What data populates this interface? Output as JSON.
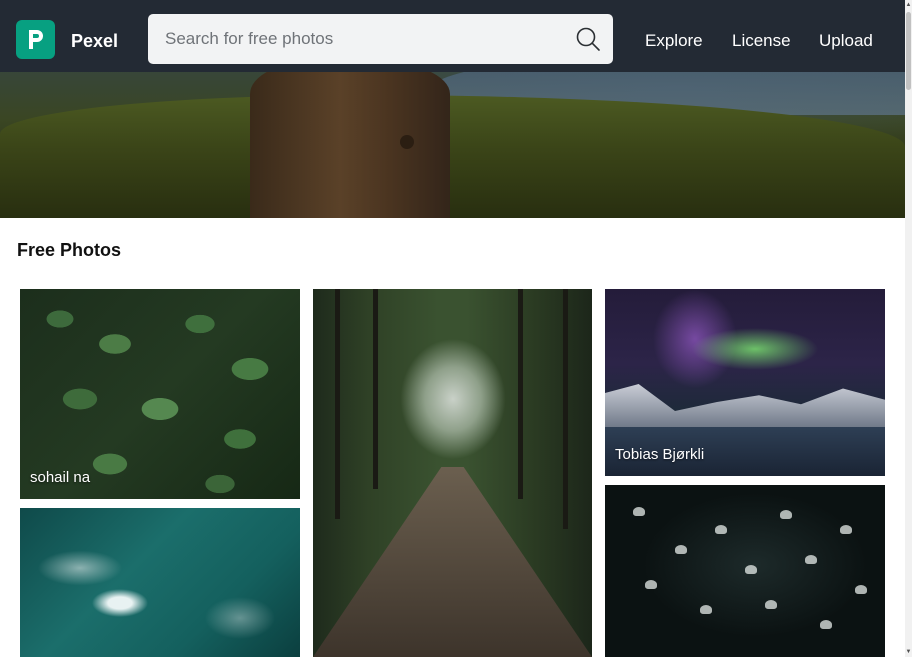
{
  "header": {
    "brand": "Pexel",
    "search": {
      "placeholder": "Search for free photos",
      "value": ""
    },
    "nav": [
      "Explore",
      "License",
      "Upload"
    ]
  },
  "section": {
    "title": "Free Photos"
  },
  "photos": [
    {
      "subject": "green leaves with water droplets",
      "credit": "sohail na"
    },
    {
      "subject": "wooden suspension bridge in forest",
      "credit": ""
    },
    {
      "subject": "northern lights over mountains and lake",
      "credit": "Tobias Bjørkli"
    },
    {
      "subject": "aerial ocean waves",
      "credit": ""
    },
    {
      "subject": "jellyfish in dark water",
      "credit": ""
    }
  ],
  "colors": {
    "header_bg": "#232a34",
    "logo_bg": "#07a081",
    "search_bg": "#f2f3f4"
  }
}
